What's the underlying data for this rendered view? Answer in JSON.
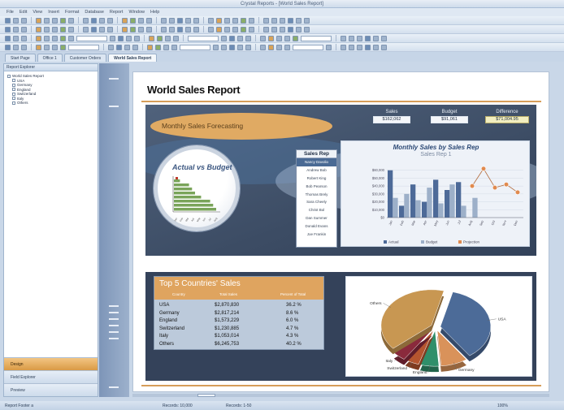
{
  "window": {
    "title": "Crystal Reports - [World Sales Report]",
    "menu": [
      "File",
      "Edit",
      "View",
      "Insert",
      "Format",
      "Database",
      "Report",
      "Window",
      "Help"
    ]
  },
  "tabs": [
    {
      "label": "Start Page",
      "active": false
    },
    {
      "label": "Office 1",
      "active": false
    },
    {
      "label": "Customer Orders",
      "active": false
    },
    {
      "label": "World Sales Report",
      "active": true
    }
  ],
  "navigator": {
    "header": "Report Explorer",
    "tree": [
      {
        "label": "World Sales Report",
        "level": 0
      },
      {
        "label": "USA",
        "level": 1
      },
      {
        "label": "Germany",
        "level": 1
      },
      {
        "label": "England",
        "level": 1
      },
      {
        "label": "Switzerland",
        "level": 1
      },
      {
        "label": "Italy",
        "level": 1
      },
      {
        "label": "Others",
        "level": 1
      }
    ],
    "buttons": [
      {
        "label": "Design",
        "active": true
      },
      {
        "label": "Field Explorer",
        "active": false
      },
      {
        "label": "Preview",
        "active": false
      }
    ]
  },
  "report": {
    "title": "World Sales Report",
    "forecast_label": "Monthly Sales Forecasting",
    "kpis": [
      {
        "label": "Sales",
        "value": "$162,062"
      },
      {
        "label": "Budget",
        "value": "$91,061"
      },
      {
        "label": "Difference",
        "value": "$71,004.95"
      }
    ],
    "actual_vs_budget_title": "Actual vs Budget",
    "sales_rep": {
      "header": "Sales Rep",
      "items": [
        "Nancy Davolio",
        "Andrew Bob",
        "Robert King",
        "Bob Pearson",
        "Thomas Brely",
        "Sara Cheely",
        "Christ Bol",
        "Dan Summer",
        "Donald Evans",
        "Joe Frankin"
      ],
      "selected_index": 0
    },
    "monthly_chart": {
      "title": "Monthly Sales by Sales Rep",
      "subtitle": "Sales Rep 1",
      "legend": [
        "Actual",
        "Budget",
        "Projection"
      ]
    },
    "top5": {
      "title": "Top 5 Countries' Sales",
      "columns": [
        "Country",
        "Total Sales",
        "Percent of Total"
      ],
      "rows": [
        {
          "country": "USA",
          "sales": "$2,870,830",
          "pct": "36.2 %"
        },
        {
          "country": "Germany",
          "sales": "$2,817,214",
          "pct": "8.6 %"
        },
        {
          "country": "England",
          "sales": "$1,573,229",
          "pct": "6.0 %"
        },
        {
          "country": "Switzerland",
          "sales": "$1,230,885",
          "pct": "4.7 %"
        },
        {
          "country": "Italy",
          "sales": "$1,053,014",
          "pct": "4.3 %"
        },
        {
          "country": "Others",
          "sales": "$6,245,753",
          "pct": "40.2 %"
        }
      ]
    },
    "pie_labels": [
      "Others",
      "USA",
      "Germany",
      "England",
      "Switzerland",
      "Italy"
    ]
  },
  "status": {
    "left": "Report Footer a",
    "mid1": "Records: 10,000",
    "mid2": "Records: 1-50",
    "zoom": "100%"
  },
  "chart_data": [
    {
      "type": "bar",
      "title": "Actual vs Budget",
      "categories": [
        "Jan",
        "Feb",
        "Mar",
        "Apr",
        "May",
        "Jun",
        "Jul",
        "Aug"
      ],
      "series": [
        {
          "name": "Actual",
          "values": [
            2,
            5,
            6,
            7,
            9,
            12,
            13,
            14
          ]
        }
      ],
      "orientation": "horizontal",
      "colors": [
        "#7aa45a"
      ]
    },
    {
      "type": "bar",
      "title": "Monthly Sales by Sales Rep",
      "categories": [
        "Jan",
        "Feb",
        "Mar",
        "Apr",
        "May",
        "Jun",
        "Jul",
        "Aug",
        "Sep",
        "Oct",
        "Nov",
        "Dec"
      ],
      "series": [
        {
          "name": "Actual",
          "values": [
            60000,
            15000,
            42000,
            20000,
            48000,
            35000,
            45000,
            0,
            0,
            0,
            0,
            0
          ]
        },
        {
          "name": "Budget",
          "values": [
            25000,
            30000,
            22000,
            38000,
            18000,
            42000,
            15000,
            25000,
            0,
            0,
            0,
            0
          ]
        },
        {
          "name": "Projection",
          "values": [
            0,
            0,
            0,
            0,
            0,
            0,
            0,
            40000,
            62000,
            38000,
            42000,
            32000
          ]
        }
      ],
      "ylim": [
        0,
        70000
      ],
      "yticks": [
        "$0",
        "$10,000",
        "$20,000",
        "$30,000",
        "$40,000",
        "$50,000",
        "$60,000"
      ]
    },
    {
      "type": "pie",
      "title": "",
      "categories": [
        "USA",
        "Germany",
        "England",
        "Switzerland",
        "Italy",
        "Others"
      ],
      "values": [
        36.2,
        8.6,
        6.0,
        4.7,
        4.3,
        40.2
      ],
      "colors": [
        "#4c6b98",
        "#d9925a",
        "#2f8f6a",
        "#b5552f",
        "#8a2a3c",
        "#c89752"
      ]
    }
  ]
}
